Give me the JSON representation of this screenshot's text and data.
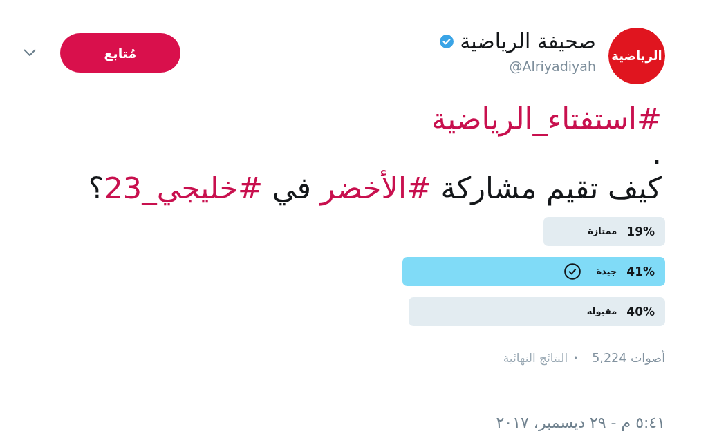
{
  "header": {
    "avatar_text": "الرياضية",
    "name": "صحيفة الرياضية",
    "verified": true,
    "handle": "@Alriyadiyah",
    "follow_button": "مُتابع"
  },
  "tweet_text": [
    [
      {
        "kind": "hashtag",
        "text": "#استفتاء_الرياضية"
      }
    ],
    [
      {
        "kind": "text",
        "text": "."
      }
    ],
    [
      {
        "kind": "text",
        "text": "كيف تقيم مشاركة "
      },
      {
        "kind": "hashtag",
        "text": "#الأخضر"
      },
      {
        "kind": "text",
        "text": " في "
      },
      {
        "kind": "hashtag",
        "text": "#خليجي_23"
      },
      {
        "kind": "text",
        "text": "؟"
      }
    ]
  ],
  "poll": {
    "options": [
      {
        "percent": "19%",
        "label": "ممتازة",
        "level": 0.19,
        "selected": false,
        "leading": false
      },
      {
        "percent": "41%",
        "label": "جيدة",
        "level": 0.41,
        "selected": true,
        "leading": true
      },
      {
        "percent": "40%",
        "label": "مقبولة",
        "level": 0.4,
        "selected": false,
        "leading": false
      }
    ],
    "votes": "أصوات 5,224",
    "separator": "•",
    "status": "النتائج النهائية"
  },
  "timestamp": "٥:٤١ م - ٢٩ ديسمبر، ٢٠١٧"
}
